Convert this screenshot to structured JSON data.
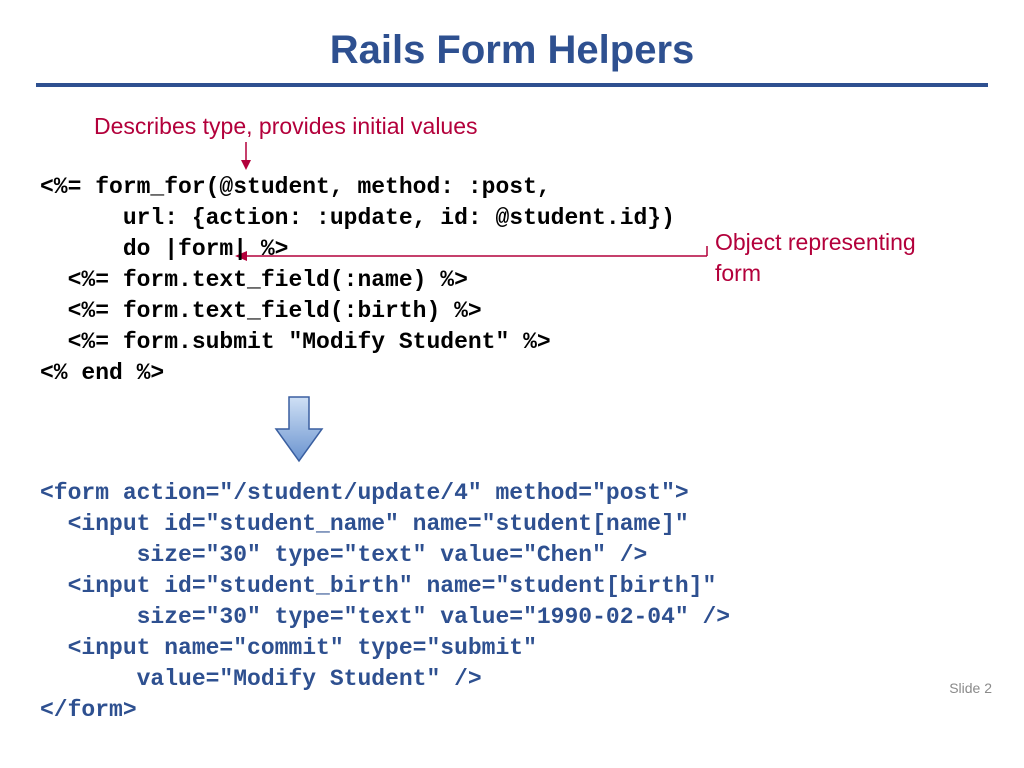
{
  "title": "Rails Form Helpers",
  "annotations": {
    "describes": "Describes type, provides initial values",
    "object_rep_l1": "Object representing",
    "object_rep_l2": "form"
  },
  "erb": {
    "l1": "<%= form_for(@student, method: :post,",
    "l2": "      url: {action: :update, id: @student.id})",
    "l3": "      do |form| %>",
    "l4": "  <%= form.text_field(:name) %>",
    "l5": "  <%= form.text_field(:birth) %>",
    "l6": "  <%= form.submit \"Modify Student\" %>",
    "l7": "<% end %>"
  },
  "html_out": {
    "l1": "<form action=\"/student/update/4\" method=\"post\">",
    "l2": "  <input id=\"student_name\" name=\"student[name]\"",
    "l3": "       size=\"30\" type=\"text\" value=\"Chen\" />",
    "l4": "  <input id=\"student_birth\" name=\"student[birth]\"",
    "l5": "       size=\"30\" type=\"text\" value=\"1990-02-04\" />",
    "l6": "  <input name=\"commit\" type=\"submit\"",
    "l7": "       value=\"Modify Student\" />",
    "l8": "</form>"
  },
  "footer": "Slide 2"
}
